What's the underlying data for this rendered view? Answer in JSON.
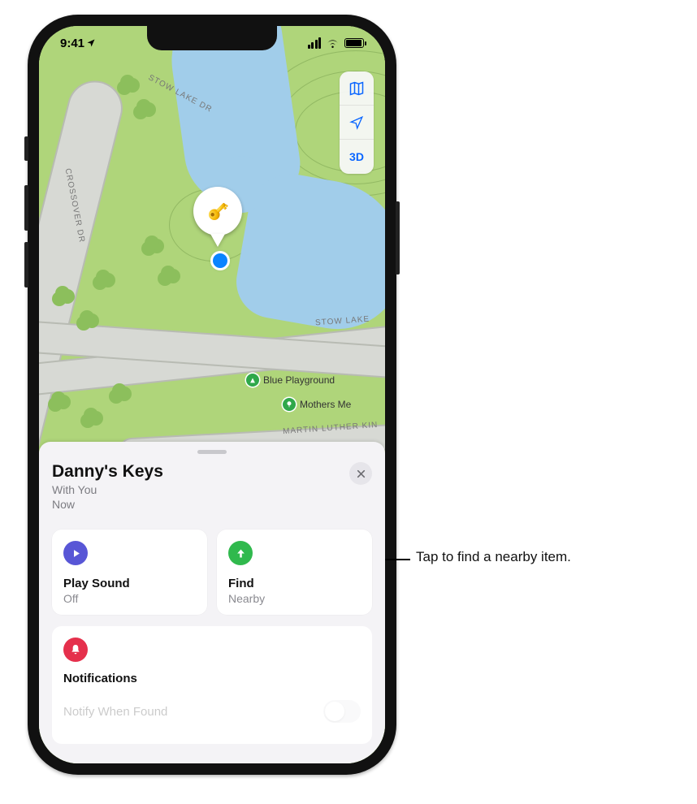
{
  "status": {
    "time": "9:41"
  },
  "map": {
    "controls": {
      "mode_3d": "3D"
    },
    "roads": {
      "stow_lake_dr_top": "Stow Lake Dr",
      "crossover_dr": "Crossover Dr",
      "stow_lake_right": "Stow Lake",
      "martin_luther": "Martin Luther Kin"
    },
    "pois": {
      "blue_playground": "Blue Playground",
      "mothers_me": "Mothers Me"
    }
  },
  "sheet": {
    "title": "Danny's Keys",
    "subtitle_line1": "With You",
    "subtitle_line2": "Now",
    "play_sound": {
      "label": "Play Sound",
      "status": "Off"
    },
    "find": {
      "label": "Find",
      "status": "Nearby"
    },
    "notifications": {
      "label": "Notifications",
      "notify_when_found": "Notify When Found"
    }
  },
  "callout": "Tap to find a nearby item."
}
